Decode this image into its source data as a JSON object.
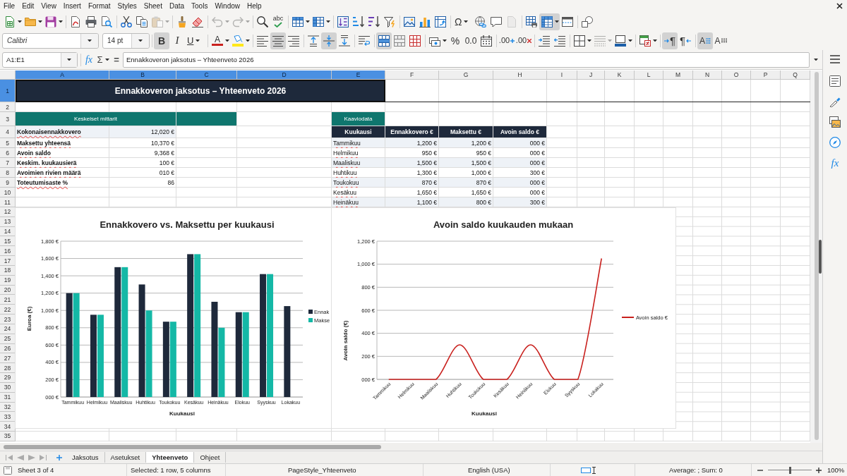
{
  "menu": [
    "File",
    "Edit",
    "View",
    "Insert",
    "Format",
    "Styles",
    "Sheet",
    "Data",
    "Tools",
    "Window",
    "Help"
  ],
  "standard_toolbar": [
    {
      "kind": "new",
      "on": false,
      "disabled": false
    },
    {
      "kind": "open",
      "on": false,
      "disabled": false
    },
    {
      "kind": "save",
      "on": false,
      "disabled": false
    },
    {
      "kind": "pdf",
      "on": false,
      "disabled": false
    },
    {
      "kind": "print",
      "on": false,
      "disabled": false
    },
    {
      "kind": "preview",
      "on": false,
      "disabled": false
    },
    {
      "kind": "cut",
      "on": false,
      "disabled": false
    },
    {
      "kind": "copy",
      "on": false,
      "disabled": false
    },
    {
      "kind": "paste",
      "on": false,
      "disabled": true
    },
    {
      "kind": "clone",
      "on": false,
      "disabled": false
    },
    {
      "kind": "clear",
      "on": false,
      "disabled": false
    },
    {
      "kind": "undo",
      "on": false,
      "disabled": true
    },
    {
      "kind": "redo",
      "on": false,
      "disabled": true
    },
    {
      "kind": "find",
      "on": false,
      "disabled": false
    },
    {
      "kind": "spelling",
      "label": "abc",
      "on": false,
      "disabled": false
    },
    {
      "kind": "rows",
      "on": false,
      "disabled": false
    },
    {
      "kind": "columns",
      "on": false,
      "disabled": false
    },
    {
      "kind": "sort",
      "on": false,
      "disabled": false
    },
    {
      "kind": "ascending",
      "on": false,
      "disabled": false
    },
    {
      "kind": "descending",
      "on": false,
      "disabled": false
    },
    {
      "kind": "autofilter",
      "on": false,
      "disabled": false
    },
    {
      "kind": "image",
      "on": false,
      "disabled": false
    },
    {
      "kind": "chart",
      "on": false,
      "disabled": false
    },
    {
      "kind": "pivot",
      "on": false,
      "disabled": false
    },
    {
      "kind": "special",
      "label": "Ω",
      "on": false,
      "disabled": false
    },
    {
      "kind": "hyperlink",
      "on": false,
      "disabled": false
    },
    {
      "kind": "comment",
      "on": false,
      "disabled": false
    },
    {
      "kind": "headers",
      "on": false,
      "disabled": true
    },
    {
      "kind": "printarea",
      "on": false,
      "disabled": false
    },
    {
      "kind": "freeze",
      "on": true,
      "disabled": false
    },
    {
      "kind": "split",
      "on": false,
      "disabled": false
    },
    {
      "kind": "shapes",
      "on": false,
      "disabled": false
    }
  ],
  "format_toolbar": [
    {
      "kind": "fontname",
      "value": "Calibri",
      "on": false,
      "disabled": false
    },
    {
      "kind": "fontsize",
      "value": "14 pt",
      "on": false,
      "disabled": false
    },
    {
      "kind": "bold",
      "label": "B",
      "on": true,
      "disabled": false
    },
    {
      "kind": "italic",
      "label": "I",
      "on": false,
      "disabled": false
    },
    {
      "kind": "underline",
      "label": "U",
      "on": false,
      "disabled": false
    },
    {
      "kind": "fontcolor",
      "label": "A",
      "on": false,
      "disabled": false
    },
    {
      "kind": "highlight",
      "on": false,
      "disabled": false
    },
    {
      "kind": "left",
      "on": false,
      "disabled": false
    },
    {
      "kind": "center",
      "on": true,
      "disabled": false
    },
    {
      "kind": "right",
      "on": false,
      "disabled": false
    },
    {
      "kind": "top",
      "on": false,
      "disabled": false
    },
    {
      "kind": "middle",
      "on": true,
      "disabled": false
    },
    {
      "kind": "bottom",
      "on": false,
      "disabled": false
    },
    {
      "kind": "wrap",
      "on": false,
      "disabled": false
    },
    {
      "kind": "mergecenter",
      "on": true,
      "disabled": false
    },
    {
      "kind": "merge",
      "on": false,
      "disabled": false
    },
    {
      "kind": "unmerge",
      "on": false,
      "disabled": false
    },
    {
      "kind": "currency",
      "on": false,
      "disabled": false
    },
    {
      "kind": "percent",
      "label": "%",
      "on": false,
      "disabled": false
    },
    {
      "kind": "number",
      "label": "0.0",
      "on": false,
      "disabled": false
    },
    {
      "kind": "date",
      "on": false,
      "disabled": false
    },
    {
      "kind": "adddecimal",
      "label": ".00",
      "on": false,
      "disabled": false
    },
    {
      "kind": "deletedecimal",
      "label": ".00",
      "on": false,
      "disabled": false
    },
    {
      "kind": "indent",
      "on": false,
      "disabled": false
    },
    {
      "kind": "outdent",
      "on": false,
      "disabled": false
    },
    {
      "kind": "borders",
      "on": false,
      "disabled": false
    },
    {
      "kind": "borderstyle",
      "on": false,
      "disabled": true
    },
    {
      "kind": "bordercolor",
      "on": false,
      "disabled": false
    },
    {
      "kind": "conditional",
      "on": false,
      "disabled": false
    },
    {
      "kind": "ltr",
      "label": "¶",
      "on": true,
      "disabled": false
    },
    {
      "kind": "rtl",
      "label": "¶",
      "on": false,
      "disabled": false
    },
    {
      "kind": "horizontal",
      "label": "A",
      "on": true,
      "disabled": false
    },
    {
      "kind": "vertical",
      "label": "A",
      "on": false,
      "disabled": false
    }
  ],
  "formula_bar": {
    "name_box": "A1:E1",
    "function_wizard": "fx",
    "autosum": "Σ",
    "formula_button": "=",
    "content": "Ennakkoveron jaksotus – Yhteenveto 2026"
  },
  "sidebar": [
    {
      "kind": "menu"
    },
    {
      "kind": "properties"
    },
    {
      "kind": "styles"
    },
    {
      "kind": "gallery"
    },
    {
      "kind": "navigator"
    },
    {
      "kind": "functions",
      "label": "fx"
    }
  ],
  "sheet": {
    "column_headers": [
      {
        "label": "A",
        "selected": true
      },
      {
        "label": "B",
        "selected": true
      },
      {
        "label": "C",
        "selected": true
      },
      {
        "label": "D",
        "selected": true
      },
      {
        "label": "E",
        "selected": true
      },
      {
        "label": "F",
        "selected": false
      },
      {
        "label": "G",
        "selected": false
      },
      {
        "label": "H",
        "selected": false
      },
      {
        "label": "I",
        "selected": false
      },
      {
        "label": "J",
        "selected": false
      },
      {
        "label": "K",
        "selected": false
      },
      {
        "label": "L",
        "selected": false
      },
      {
        "label": "M",
        "selected": false
      },
      {
        "label": "N",
        "selected": false
      },
      {
        "label": "O",
        "selected": false
      },
      {
        "label": "P",
        "selected": false
      },
      {
        "label": "Q",
        "selected": false
      }
    ],
    "row_headers": [
      {
        "label": "1",
        "selected": true
      },
      {
        "label": "2",
        "selected": false
      },
      {
        "label": "3",
        "selected": false
      },
      {
        "label": "4",
        "selected": false
      },
      {
        "label": "5",
        "selected": false
      },
      {
        "label": "6",
        "selected": false
      },
      {
        "label": "7",
        "selected": false
      },
      {
        "label": "8",
        "selected": false
      },
      {
        "label": "9",
        "selected": false
      },
      {
        "label": "10",
        "selected": false
      },
      {
        "label": "11",
        "selected": false
      },
      {
        "label": "12",
        "selected": false
      },
      {
        "label": "13",
        "selected": false
      },
      {
        "label": "14",
        "selected": false
      },
      {
        "label": "15",
        "selected": false
      },
      {
        "label": "16",
        "selected": false
      },
      {
        "label": "17",
        "selected": false
      },
      {
        "label": "18",
        "selected": false
      },
      {
        "label": "19",
        "selected": false
      },
      {
        "label": "20",
        "selected": false
      },
      {
        "label": "21",
        "selected": false
      },
      {
        "label": "22",
        "selected": false
      },
      {
        "label": "23",
        "selected": false
      },
      {
        "label": "24",
        "selected": false
      },
      {
        "label": "25",
        "selected": false
      },
      {
        "label": "26",
        "selected": false
      },
      {
        "label": "27",
        "selected": false
      },
      {
        "label": "28",
        "selected": false
      },
      {
        "label": "29",
        "selected": false
      },
      {
        "label": "30",
        "selected": false
      },
      {
        "label": "31",
        "selected": false
      },
      {
        "label": "32",
        "selected": false
      },
      {
        "label": "33",
        "selected": false
      },
      {
        "label": "34",
        "selected": false
      },
      {
        "label": "35",
        "selected": false
      }
    ],
    "title": {
      "text": "Ennakkoveron jaksotus – Yhteenveto 2026",
      "selected": true
    },
    "metrics": {
      "heading": "Keskeiset mittarit",
      "items": [
        {
          "label": "Kokonaisennakkovero",
          "value": "12,020 €"
        },
        {
          "label": "Maksettu yhteensä",
          "value": "10,370 €"
        },
        {
          "label": "Avoin saldo",
          "value": "9,368 €"
        },
        {
          "label": "Keskim. kuukausierä",
          "value": "100 €"
        },
        {
          "label": "Avoimien rivien määrä",
          "value": "010 €"
        },
        {
          "label": "Toteutumisaste %",
          "value": "86"
        }
      ]
    },
    "chart_table": {
      "heading": "Kaaviodata",
      "columns": [
        "Kuukausi",
        "Ennakkovero €",
        "Maksettu €",
        "Avoin saldo €"
      ],
      "rows": [
        [
          "Tammikuu",
          "1,200 €",
          "1,200 €",
          "000 €"
        ],
        [
          "Helmikuu",
          "950 €",
          "950 €",
          "000 €"
        ],
        [
          "Maaliskuu",
          "1,500 €",
          "1,500 €",
          "000 €"
        ],
        [
          "Huhtikuu",
          "1,300 €",
          "1,000 €",
          "300 €"
        ],
        [
          "Toukokuu",
          "870 €",
          "870 €",
          "000 €"
        ],
        [
          "Kesäkuu",
          "1,650 €",
          "1,650 €",
          "000 €"
        ],
        [
          "Heinäkuu",
          "1,100 €",
          "800 €",
          "300 €"
        ]
      ]
    }
  },
  "charts": [
    {
      "chart_data": {
        "type": "bar",
        "title": "Ennakkovero vs. Maksettu per kuukausi",
        "xlabel": "Kuukausi",
        "ylabel": "Euroa (€)",
        "categories": [
          "Tammikuu",
          "Helmikuu",
          "Maaliskuu",
          "Huhtikuu",
          "Toukokuu",
          "Kesäkuu",
          "Heinäkuu",
          "Elokuu",
          "Syyskuu",
          "Lokakuu"
        ],
        "series": [
          {
            "name": "Ennak",
            "color": "#1e293b",
            "values": [
              1200,
              950,
              1500,
              1300,
              870,
              1650,
              1100,
              980,
              1420,
              1050
            ]
          },
          {
            "name": "Makse",
            "color": "#14b8a6",
            "values": [
              1200,
              950,
              1500,
              1000,
              870,
              1650,
              800,
              980,
              1420,
              null
            ]
          }
        ],
        "ylim": [
          0,
          1800
        ],
        "yticks": [
          {
            "value": 0,
            "label": "000 €"
          },
          {
            "value": 200,
            "label": "200 €"
          },
          {
            "value": 400,
            "label": "400 €"
          },
          {
            "value": 600,
            "label": "600 €"
          },
          {
            "value": 800,
            "label": "800 €"
          },
          {
            "value": 1000,
            "label": "1,000 €"
          },
          {
            "value": 1200,
            "label": "1,200 €"
          },
          {
            "value": 1400,
            "label": "1,400 €"
          },
          {
            "value": 1600,
            "label": "1,600 €"
          },
          {
            "value": 1800,
            "label": "1,800 €"
          }
        ],
        "grid": true,
        "legend": "right"
      }
    },
    {
      "chart_data": {
        "type": "line",
        "title": "Avoin saldo kuukauden mukaan",
        "xlabel": "Kuukausi",
        "ylabel": "Avoin saldo (€)",
        "categories": [
          "Tammikuu",
          "Helmikuu",
          "Maaliskuu",
          "Huhtikuu",
          "Toukokuu",
          "Kesäkuu",
          "Heinäkuu",
          "Elokuu",
          "Syyskuu",
          "Lokakuu"
        ],
        "series": [
          {
            "name": "Avoin saldo €",
            "color": "#c9211e",
            "values": [
              0,
              0,
              0,
              300,
              0,
              0,
              300,
              0,
              0,
              1050
            ]
          }
        ],
        "ylim": [
          0,
          1200
        ],
        "yticks": [
          {
            "value": 0,
            "label": "000 €"
          },
          {
            "value": 200,
            "label": "200 €"
          },
          {
            "value": 400,
            "label": "400 €"
          },
          {
            "value": 600,
            "label": "600 €"
          },
          {
            "value": 800,
            "label": "800 €"
          },
          {
            "value": 1000,
            "label": "1,000 €"
          },
          {
            "value": 1200,
            "label": "1,200 €"
          }
        ],
        "grid": true,
        "legend": "right"
      }
    }
  ],
  "sheet_tabs": [
    {
      "label": "Jaksotus",
      "selected": false
    },
    {
      "label": "Asetukset",
      "selected": false
    },
    {
      "label": "Yhteenveto",
      "selected": true
    },
    {
      "label": "Ohjeet",
      "selected": false
    }
  ],
  "status_bar": {
    "sheet": "Sheet 3 of 4",
    "selection": "Selected: 1 row, 5 columns",
    "page_style": "PageStyle_Yhteenveto",
    "language": "English (USA)",
    "summary": "Average: ; Sum: 0",
    "zoom": {
      "level": 0.5,
      "reading": "100%"
    }
  }
}
